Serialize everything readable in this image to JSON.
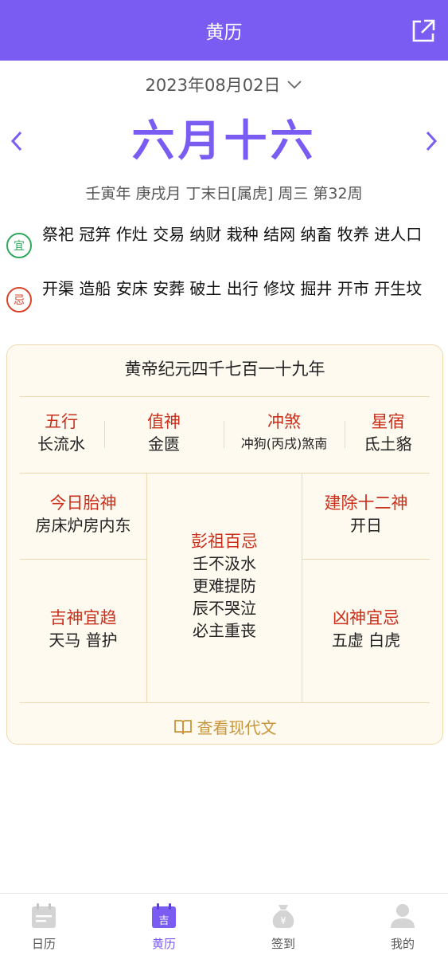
{
  "header": {
    "title": "黄历"
  },
  "date": {
    "text": "2023年08月02日"
  },
  "lunar": {
    "text": "六月十六"
  },
  "ganzhi": {
    "text": "壬寅年 庚戌月 丁末日[属虎] 周三 第32周"
  },
  "yi": {
    "badge": "宜",
    "text": "祭祀 冠笄 作灶 交易 纳财 栽种 结网 纳畜 牧养 进人口"
  },
  "ji": {
    "badge": "忌",
    "text": "开渠 造船 安床 安葬 破土 出行 修坟 掘井 开市 开生坟"
  },
  "card": {
    "title": "黄帝纪元四千七百一十九年",
    "wuxing": {
      "label": "五行",
      "value": "长流水"
    },
    "zhishen": {
      "label": "值神",
      "value": "金匮"
    },
    "chongsha": {
      "label": "冲煞",
      "value": "冲狗(丙戌)煞南"
    },
    "xingxiu": {
      "label": "星宿",
      "value": "氐土貉"
    },
    "taishen": {
      "label": "今日胎神",
      "value": "房床炉房内东"
    },
    "jianchu": {
      "label": "建除十二神",
      "value": "开日"
    },
    "pengzu": {
      "label": "彭祖百忌",
      "line1": "壬不汲水",
      "line2": "更难提防",
      "line3": "辰不哭泣",
      "line4": "必主重丧"
    },
    "jishen": {
      "label": "吉神宜趋",
      "value": "天马 普护"
    },
    "xiongshen": {
      "label": "凶神宜忌",
      "value": "五虚 白虎"
    },
    "modern_link": "查看现代文"
  },
  "tabs": [
    {
      "label": "日历",
      "icon": "calendar-icon",
      "active": false
    },
    {
      "label": "黄历",
      "icon": "almanac-icon",
      "icon_text": "吉",
      "active": true
    },
    {
      "label": "签到",
      "icon": "money-bag-icon",
      "active": false
    },
    {
      "label": "我的",
      "icon": "user-icon",
      "active": false
    }
  ],
  "colors": {
    "accent": "#7b5cf3",
    "red": "#c9301c",
    "green": "#2fa85e",
    "gold": "#c8953a",
    "card_bg": "#fffaf0"
  }
}
